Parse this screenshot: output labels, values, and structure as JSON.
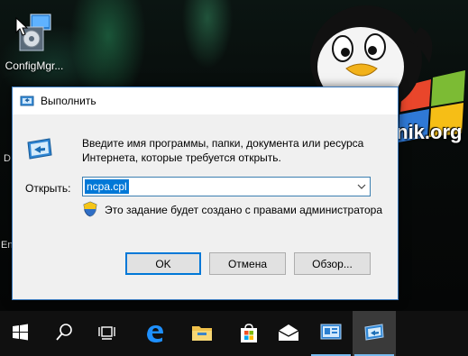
{
  "desktop": {
    "icon_label": "ConfigMgr...",
    "edge_letters": [
      "D",
      "En"
    ]
  },
  "logo": {
    "site": "pyatilistnik.org"
  },
  "dialog": {
    "title": "Выполнить",
    "description": "Введите имя программы, папки, документа или ресурса Интернета, которые требуется открыть.",
    "open_label": "Открыть:",
    "open_value": "ncpa.cpl",
    "admin_note": "Это задание будет создано с правами администратора",
    "buttons": {
      "ok": "OK",
      "cancel": "Отмена",
      "browse": "Обзор..."
    }
  },
  "taskbar": {
    "items": [
      "start",
      "search",
      "task-view",
      "edge",
      "file-explorer",
      "store",
      "mail",
      "server-manager",
      "run"
    ]
  },
  "colors": {
    "accent": "#0078d7",
    "taskbar": "#101010",
    "dialog_bg": "#f0f0f0"
  }
}
